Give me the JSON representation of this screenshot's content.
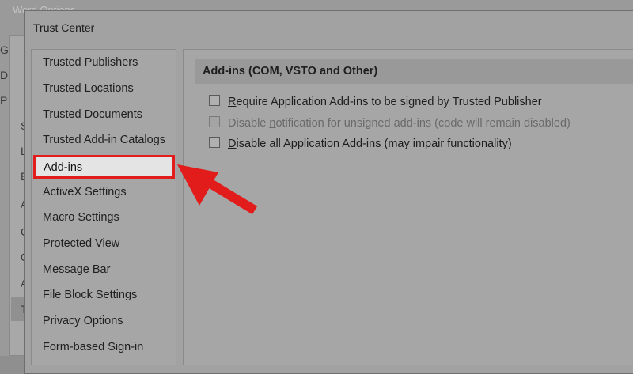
{
  "background_window": {
    "title": "Word Options",
    "sidebar_letters": [
      "G",
      "D",
      "P",
      "S",
      "L",
      "E",
      "A",
      "C",
      "Q",
      "A",
      "T"
    ]
  },
  "dialog": {
    "title": "Trust Center",
    "nav_items": [
      {
        "label": "Trusted Publishers"
      },
      {
        "label": "Trusted Locations"
      },
      {
        "label": "Trusted Documents"
      },
      {
        "label": "Trusted Add-in Catalogs"
      },
      {
        "label": "Add-ins",
        "selected": true
      },
      {
        "label": "ActiveX Settings"
      },
      {
        "label": "Macro Settings"
      },
      {
        "label": "Protected View"
      },
      {
        "label": "Message Bar"
      },
      {
        "label": "File Block Settings"
      },
      {
        "label": "Privacy Options"
      },
      {
        "label": "Form-based Sign-in"
      }
    ],
    "section": {
      "title": "Add-ins (COM, VSTO and Other)",
      "options": [
        {
          "accel": "R",
          "rest": "equire Application Add-ins to be signed by Trusted Publisher",
          "checked": false,
          "disabled": false
        },
        {
          "pre": "Disable ",
          "accel": "n",
          "rest": "otification for unsigned add-ins (code will remain disabled)",
          "checked": false,
          "disabled": true
        },
        {
          "accel": "D",
          "rest": "isable all Application Add-ins (may impair functionality)",
          "checked": false,
          "disabled": false
        }
      ]
    }
  },
  "annotation": {
    "color": "#e21b1b"
  }
}
